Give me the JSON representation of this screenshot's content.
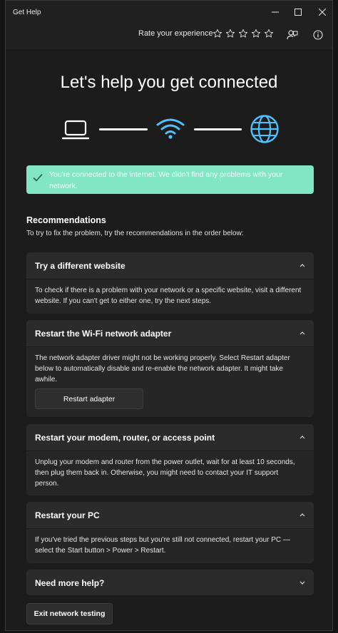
{
  "window": {
    "title": "Get Help",
    "controls": {
      "minimize": "─",
      "maximize": "☐",
      "close": "✕"
    }
  },
  "rating": {
    "label": "Rate your experience",
    "stars_total": 5,
    "stars_filled": 0
  },
  "header_icons": [
    "feedback-icon",
    "info-icon"
  ],
  "hero": {
    "title": "Let's help you get connected",
    "diagram": [
      "laptop-icon",
      "wifi-icon",
      "globe-icon"
    ],
    "accent_color": "#4cc2ff"
  },
  "banner": {
    "text": "You're connected to the internet. We didn't find any problems with your network.",
    "color": "#82e6c4",
    "icon": "checkmark-icon"
  },
  "recommendations": {
    "title": "Recommendations",
    "subtitle": "To try to fix the problem, try the recommendations in the order below:"
  },
  "cards": [
    {
      "title": "Try a different website",
      "body": "To check if there is a problem with your network or a specific website, visit a different website. If you can't get to either one, try the next steps.",
      "expanded": true
    },
    {
      "title": "Restart the Wi-Fi network adapter",
      "body": "The network adapter driver might not be working properly. Select Restart adapter below to automatically disable and re-enable the network adapter. It might take awhile.",
      "button": "Restart adapter",
      "expanded": true
    },
    {
      "title": "Restart your modem, router, or access point",
      "body": "Unplug your modem and router from the power outlet, wait for at least 10 seconds, then plug them back in. Otherwise, you might need to contact your IT support person.",
      "expanded": true
    },
    {
      "title": "Restart your PC",
      "body": "If you've tried the previous steps but you're still not connected, restart your PC —select the Start button > Power > Restart.",
      "expanded": true
    },
    {
      "title": "Need more help?",
      "expanded": false
    }
  ],
  "footer": {
    "exit_button": "Exit network testing"
  }
}
